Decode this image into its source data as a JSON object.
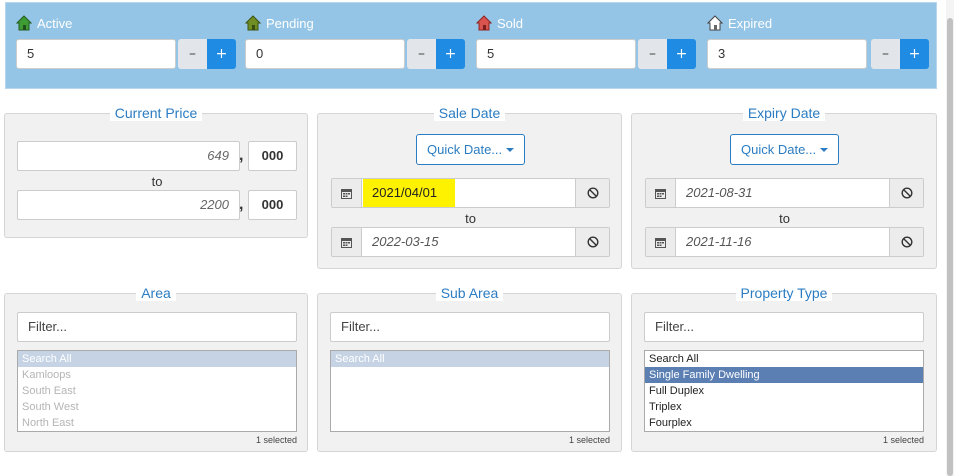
{
  "status": [
    {
      "label": "Active",
      "value": "5",
      "icon": "house-green-icon",
      "color": "#3e9c35"
    },
    {
      "label": "Pending",
      "value": "0",
      "icon": "house-olive-icon",
      "color": "#6f8f25"
    },
    {
      "label": "Sold",
      "value": "5",
      "icon": "house-red-icon",
      "color": "#d9534f"
    },
    {
      "label": "Expired",
      "value": "3",
      "icon": "house-white-icon",
      "color": "#ffffff"
    }
  ],
  "buttons": {
    "minus": "–",
    "plus": "+"
  },
  "current_price": {
    "legend": "Current Price",
    "from": "649",
    "from_thousands": "000",
    "to": "2200",
    "to_thousands": "000",
    "comma": ",",
    "to_label": "to"
  },
  "sale_date": {
    "legend": "Sale Date",
    "quick_label": "Quick Date...",
    "from": "2021/04/01",
    "to": "2022-03-15",
    "to_label": "to"
  },
  "expiry_date": {
    "legend": "Expiry Date",
    "quick_label": "Quick Date...",
    "from": "2021-08-31",
    "to": "2021-11-16",
    "to_label": "to"
  },
  "area": {
    "legend": "Area",
    "filter_placeholder": "Filter...",
    "items": [
      "Search All",
      "Kamloops",
      "South East",
      "South West",
      "North East"
    ],
    "selected_count": "1 selected"
  },
  "sub_area": {
    "legend": "Sub Area",
    "filter_placeholder": "Filter...",
    "items": [
      "Search All"
    ],
    "selected_count": "1 selected"
  },
  "property_type": {
    "legend": "Property Type",
    "filter_placeholder": "Filter...",
    "items": [
      "Search All",
      "Single Family Dwelling",
      "Full Duplex",
      "Triplex",
      "Fourplex"
    ],
    "selected_count": "1 selected"
  },
  "colors": {
    "accent": "#2b7cc2",
    "plus_button": "#1f8be2",
    "status_bar": "#95c5e6",
    "highlight": "#fff200"
  }
}
